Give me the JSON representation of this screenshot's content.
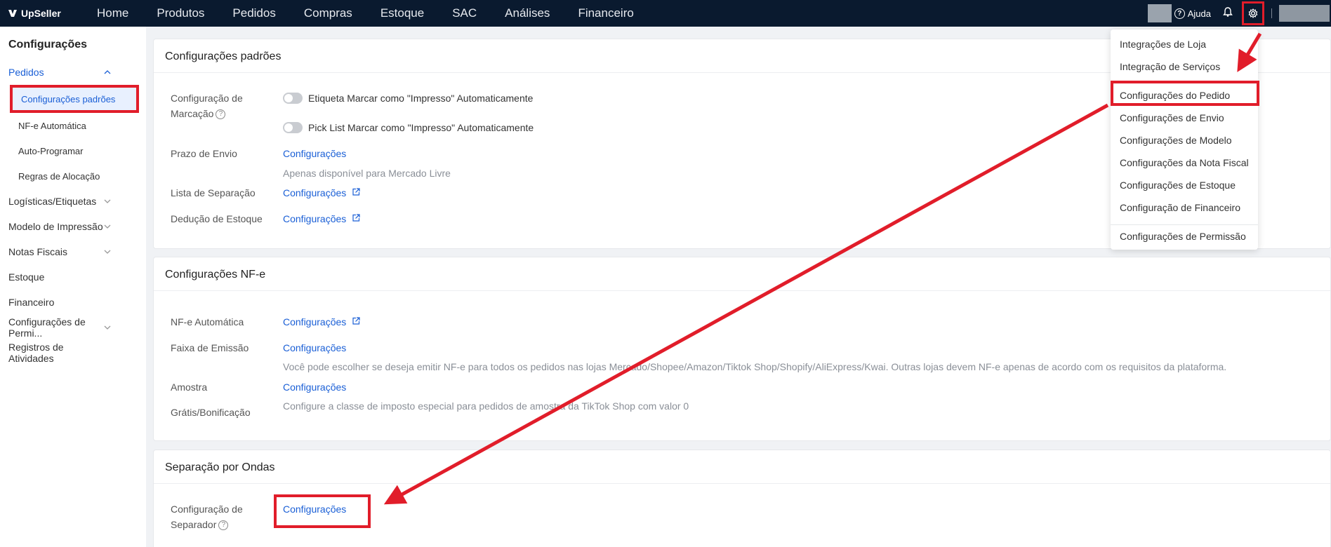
{
  "app": {
    "brand": "UpSeller",
    "nav": [
      "Home",
      "Produtos",
      "Pedidos",
      "Compras",
      "Estoque",
      "SAC",
      "Análises",
      "Financeiro"
    ],
    "help": "Ajuda"
  },
  "sidebar": {
    "title": "Configurações",
    "group_pedidos": "Pedidos",
    "sub": [
      "Configurações padrões",
      "NF-e Automática",
      "Auto-Programar",
      "Regras de Alocação"
    ],
    "items": [
      "Logísticas/Etiquetas",
      "Modelo de Impressão",
      "Notas Fiscais",
      "Estoque",
      "Financeiro",
      "Configurações de Permi...",
      "Registros de Atividades"
    ]
  },
  "card1": {
    "title": "Configurações padrões",
    "marcacao_label": "Configuração de Marcação",
    "toggle1": "Etiqueta Marcar como \"Impresso\" Automaticamente",
    "toggle2": "Pick List Marcar como \"Impresso\" Automaticamente",
    "prazo_label": "Prazo de Envio",
    "prazo_link": "Configurações",
    "prazo_note": "Apenas disponível para Mercado Livre",
    "lista_label": "Lista de Separação",
    "lista_link": "Configurações",
    "deducao_label": "Dedução de Estoque",
    "deducao_link": "Configurações"
  },
  "card2": {
    "title": "Configurações NF-e",
    "auto_label": "NF-e Automática",
    "auto_link": "Configurações",
    "faixa_label": "Faixa de Emissão",
    "faixa_link": "Configurações",
    "faixa_note": "Você pode escolher se deseja emitir NF-e para todos os pedidos nas lojas Mercado/Shopee/Amazon/Tiktok Shop/Shopify/AliExpress/Kwai. Outras lojas devem NF-e apenas de acordo com os requisitos da plataforma.",
    "amostra_label": "Amostra",
    "amostra_link": "Configurações",
    "gratis_label": "Grátis/Bonificação",
    "gratis_note": "Configure a classe de imposto especial para pedidos de amostra da TikTok Shop com valor 0"
  },
  "card3": {
    "title": "Separação por Ondas",
    "sep_label": "Configuração de Separador",
    "sep_link": "Configurações"
  },
  "dropdown": [
    "Integrações de Loja",
    "Integração de Serviços",
    "Configurações do Pedido",
    "Configurações de Envio",
    "Configurações de Modelo",
    "Configurações da Nota Fiscal",
    "Configurações de Estoque",
    "Configuração de Financeiro",
    "Configurações de Permissão"
  ],
  "colors": {
    "accent": "#1a5fd6",
    "annotation": "#e11d2a",
    "topbar": "#0a1a2f"
  }
}
